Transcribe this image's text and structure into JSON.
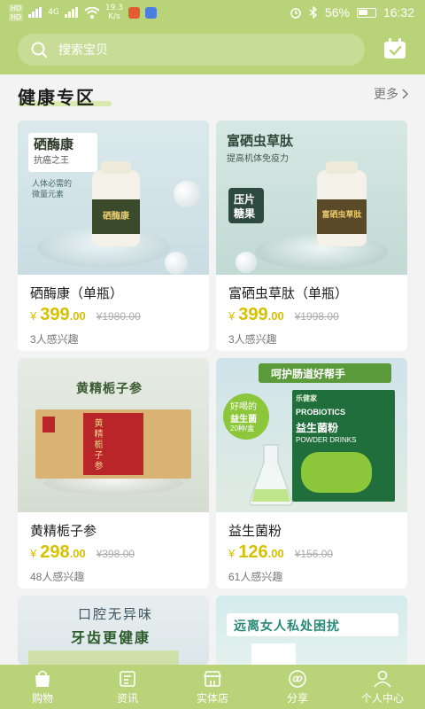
{
  "status_bar": {
    "sim1": "HD",
    "sim2": "HD",
    "network": "4G",
    "net_speed_value": "19.3",
    "net_speed_unit": "K/s",
    "battery": "56%",
    "time": "16:32"
  },
  "search": {
    "placeholder": "搜索宝贝"
  },
  "section": {
    "title": "健康专区",
    "more": "更多"
  },
  "products": [
    {
      "name": "硒酶康（单瓶）",
      "price_int": "399",
      "price_dec": ".00",
      "currency": "¥",
      "original": "¥1980.00",
      "interest": "3人感兴趣",
      "art": {
        "headline": "硒酶康",
        "sub": "抗癌之王",
        "line1": "人体必需的",
        "line2": "微量元素",
        "label": "硒酶康"
      }
    },
    {
      "name": "富硒虫草肽（单瓶）",
      "price_int": "399",
      "price_dec": ".00",
      "currency": "¥",
      "original": "¥1998.00",
      "interest": "3人感兴趣",
      "art": {
        "headline": "富硒虫草肽",
        "sub": "提高机体免疫力",
        "tag1": "压片",
        "tag2": "糖果",
        "label": "富硒虫草肽"
      }
    },
    {
      "name": "黄精栀子参",
      "price_int": "298",
      "price_dec": ".00",
      "currency": "¥",
      "original": "¥398.00",
      "interest": "48人感兴趣",
      "art": {
        "headline": "黄精栀子参",
        "box_text": "黄精栀子参"
      }
    },
    {
      "name": "益生菌粉",
      "price_int": "126",
      "price_dec": ".00",
      "currency": "¥",
      "original": "¥156.00",
      "interest": "61人感兴趣",
      "art": {
        "banner": "呵护肠道好帮手",
        "bubble1": "好喝的",
        "bubble2": "益生菌",
        "bubble3": "20种/盒",
        "box_en1": "PROBIOTICS",
        "box_cn": "益生菌粉",
        "box_en2": "POWDER DRINKS",
        "brand": "乐健家"
      }
    },
    {
      "art": {
        "line1": "口腔无异味",
        "line2": "牙齿更健康"
      }
    },
    {
      "art": {
        "banner": "远离女人私处困扰"
      }
    }
  ],
  "nav": [
    {
      "label": "购物",
      "icon": "shopping-bag-icon"
    },
    {
      "label": "资讯",
      "icon": "news-icon"
    },
    {
      "label": "实体店",
      "icon": "store-icon"
    },
    {
      "label": "分享",
      "icon": "share-link-icon"
    },
    {
      "label": "个人中心",
      "icon": "person-icon"
    }
  ],
  "colors": {
    "accent": "#b8d378",
    "price": "#d6c100"
  }
}
